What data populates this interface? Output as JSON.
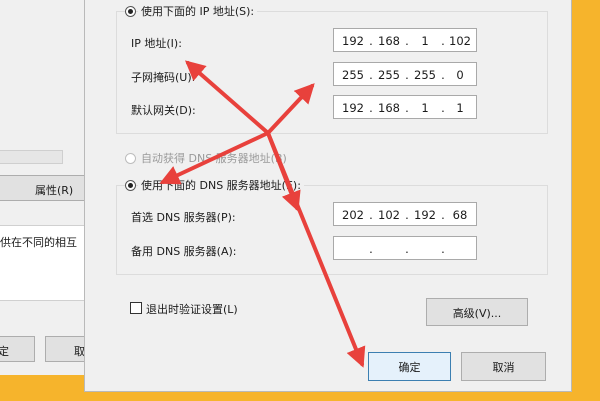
{
  "background_window": {
    "properties_button": "属性(R)",
    "description_fragment": "供在不同的相互",
    "ok_fragment": "定",
    "cancel_fragment": "取"
  },
  "ip_section": {
    "use_following_ip": "使用下面的 IP 地址(S):",
    "ip_label": "IP 地址(I):",
    "ip_octets": [
      "192",
      "168",
      "1",
      "102"
    ],
    "subnet_label": "子网掩码(U):",
    "subnet_octets": [
      "255",
      "255",
      "255",
      "0"
    ],
    "gateway_label": "默认网关(D):",
    "gateway_octets": [
      "192",
      "168",
      "1",
      "1"
    ]
  },
  "dns_section": {
    "auto_dns": "自动获得 DNS 服务器地址(B)",
    "use_following_dns": "使用下面的 DNS 服务器地址(E):",
    "preferred_label": "首选 DNS 服务器(P):",
    "preferred_octets": [
      "202",
      "102",
      "192",
      "68"
    ],
    "alternate_label": "备用 DNS 服务器(A):",
    "alternate_octets": [
      "",
      "",
      "",
      ""
    ]
  },
  "validate_on_exit": "退出时验证设置(L)",
  "advanced_button": "高级(V)...",
  "ok_button": "确定",
  "cancel_button": "取消",
  "colors": {
    "desktop": "#f6b42c",
    "dialog": "#f0f0f0",
    "annotation_arrow": "#e8413c"
  }
}
